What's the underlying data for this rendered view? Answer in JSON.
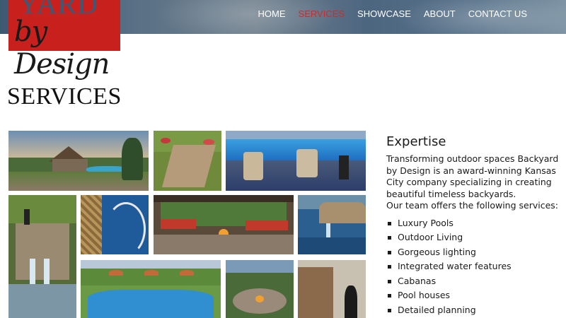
{
  "logo": {
    "line1": "YARD",
    "line2": "by Design"
  },
  "nav": {
    "items": [
      {
        "label": "HOME"
      },
      {
        "label": "SERVICES"
      },
      {
        "label": "SHOWCASE"
      },
      {
        "label": "ABOUT"
      },
      {
        "label": "CONTACT US"
      }
    ],
    "active": "SERVICES",
    "active_color": "#d22a2a"
  },
  "page": {
    "title": "SERVICES"
  },
  "expertise": {
    "heading": "Expertise",
    "intro": "Transforming outdoor spaces Backyard by Design is an award-winning Kansas City company specializing in creating beautiful timeless backyards.",
    "services_intro": "Our team offers the following services:",
    "services": [
      "Luxury Pools",
      "Outdoor Living",
      "Gorgeous lighting",
      "Integrated water features",
      "Cabanas",
      "Pool houses",
      "Detailed planning"
    ]
  },
  "gallery": {
    "photos": [
      {
        "name": "cabana-pool-yard-photo"
      },
      {
        "name": "stone-steps-garden-photo"
      },
      {
        "name": "pool-patio-chairs-photo"
      },
      {
        "name": "stone-waterfall-photo"
      },
      {
        "name": "mosaic-tile-pool-photo"
      },
      {
        "name": "covered-patio-firepit-photo"
      },
      {
        "name": "pool-edge-fountain-photo"
      },
      {
        "name": "pool-lawn-umbrellas-photo"
      },
      {
        "name": "firepit-circle-seating-photo"
      },
      {
        "name": "stone-pillar-lantern-photo"
      }
    ]
  },
  "colors": {
    "brand_red": "#c8201c",
    "header_blue": "#4d6680"
  }
}
